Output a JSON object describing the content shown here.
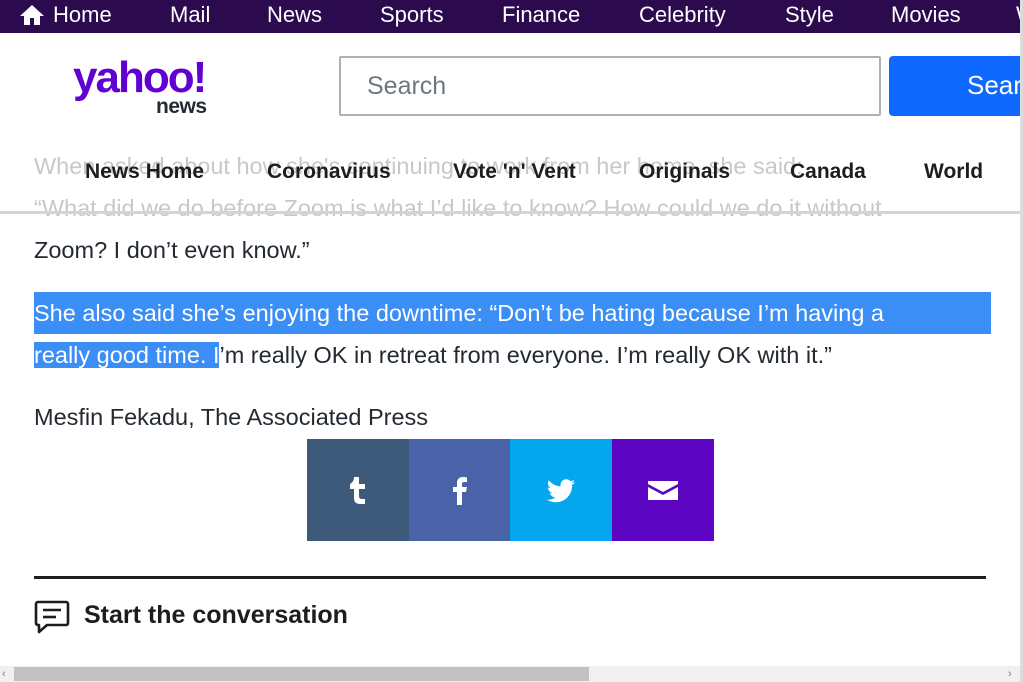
{
  "topnav": {
    "home": "Home",
    "items": [
      "Mail",
      "News",
      "Sports",
      "Finance",
      "Celebrity",
      "Style",
      "Movies",
      "W"
    ]
  },
  "header": {
    "logo_main": "yahoo!",
    "logo_sub": "news",
    "search_placeholder": "Search",
    "search_button": "Search"
  },
  "subnav": {
    "items": [
      "News Home",
      "Coronavirus",
      "Vote 'n' Vent",
      "Originals",
      "Canada",
      "World"
    ]
  },
  "article": {
    "p1_line1": "When asked about how she's continuing to work from her home, she said:",
    "p1_line2": "“What did we do before Zoom is what I’d like to know? How could we do it without",
    "p1_line3": "Zoom? I don’t even know.”",
    "p2_line1": "She also said she’s enjoying the downtime: “Don’t be hating because I’m having a",
    "p2_line2_selected": "really good time. I",
    "p2_line2_rest": "’m really OK in retreat from everyone. I’m really OK with it.”",
    "credit": "Mesfin Fekadu, The Associated Press"
  },
  "share": {
    "icons": [
      "tumblr-icon",
      "facebook-icon",
      "twitter-icon",
      "mail-icon"
    ],
    "colors": [
      "#3d5a7a",
      "#4a63a8",
      "#04a7ee",
      "#5c06c4"
    ]
  },
  "conversation": {
    "title": "Start the conversation"
  },
  "colors": {
    "topbar": "#2b0b4e",
    "brand": "#6001d2",
    "search_button": "#0f69ff",
    "selection": "#3a8ef6"
  }
}
